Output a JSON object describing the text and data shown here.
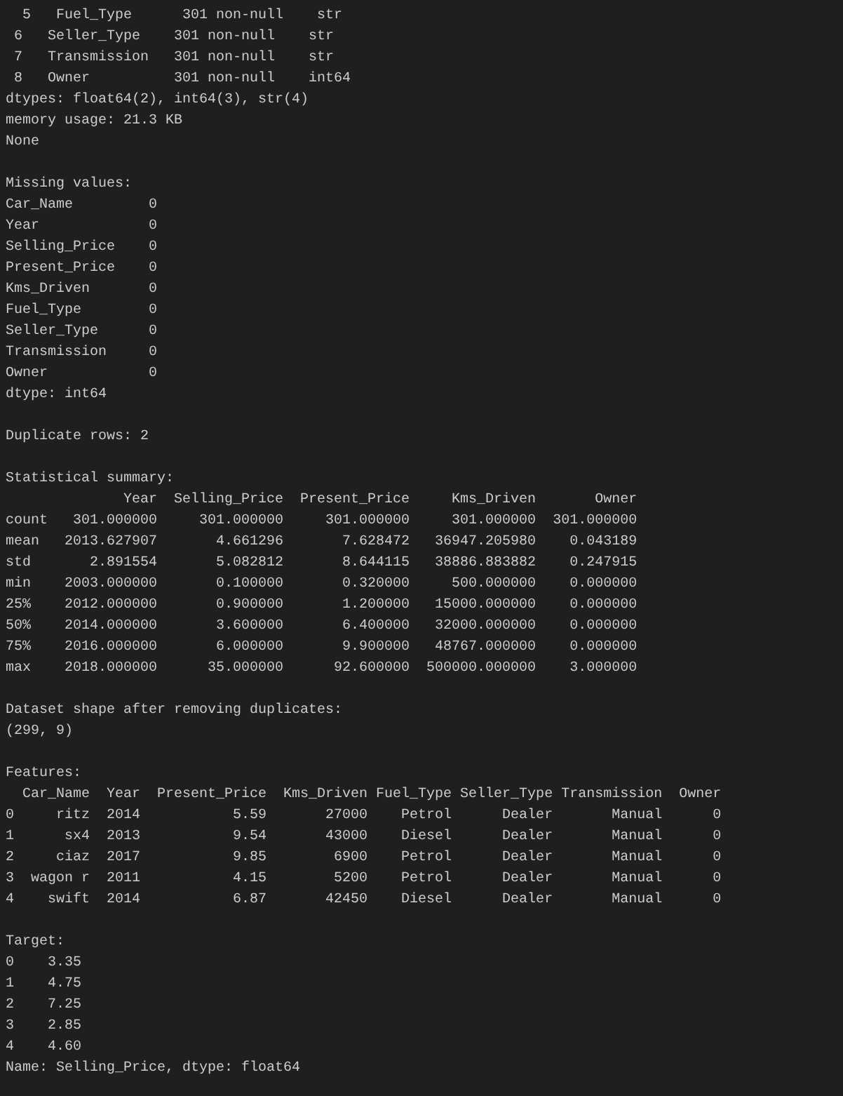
{
  "terminal": {
    "blocks": [
      [
        "  5   Fuel_Type      301 non-null    str",
        " 6   Seller_Type    301 non-null    str",
        " 7   Transmission   301 non-null    str",
        " 8   Owner          301 non-null    int64",
        "dtypes: float64(2), int64(3), str(4)",
        "memory usage: 21.3 KB",
        "None"
      ],
      [
        "Missing values:",
        "Car_Name         0",
        "Year             0",
        "Selling_Price    0",
        "Present_Price    0",
        "Kms_Driven       0",
        "Fuel_Type        0",
        "Seller_Type      0",
        "Transmission     0",
        "Owner            0",
        "dtype: int64"
      ],
      [
        "Duplicate rows: 2"
      ],
      [
        "Statistical summary:",
        "              Year  Selling_Price  Present_Price     Kms_Driven       Owner",
        "count   301.000000     301.000000     301.000000     301.000000  301.000000",
        "mean   2013.627907       4.661296       7.628472   36947.205980    0.043189",
        "std       2.891554       5.082812       8.644115   38886.883882    0.247915",
        "min    2003.000000       0.100000       0.320000     500.000000    0.000000",
        "25%    2012.000000       0.900000       1.200000   15000.000000    0.000000",
        "50%    2014.000000       3.600000       6.400000   32000.000000    0.000000",
        "75%    2016.000000       6.000000       9.900000   48767.000000    0.000000",
        "max    2018.000000      35.000000      92.600000  500000.000000    3.000000"
      ],
      [
        "Dataset shape after removing duplicates:",
        "(299, 9)"
      ],
      [
        "Features:",
        "  Car_Name  Year  Present_Price  Kms_Driven Fuel_Type Seller_Type Transmission  Owner",
        "0     ritz  2014           5.59       27000    Petrol      Dealer       Manual      0",
        "1      sx4  2013           9.54       43000    Diesel      Dealer       Manual      0",
        "2     ciaz  2017           9.85        6900    Petrol      Dealer       Manual      0",
        "3  wagon r  2011           4.15        5200    Petrol      Dealer       Manual      0",
        "4    swift  2014           6.87       42450    Diesel      Dealer       Manual      0"
      ],
      [
        "Target:",
        "0    3.35",
        "1    4.75",
        "2    7.25",
        "3    2.85",
        "4    4.60",
        "Name: Selling_Price, dtype: float64"
      ]
    ]
  }
}
